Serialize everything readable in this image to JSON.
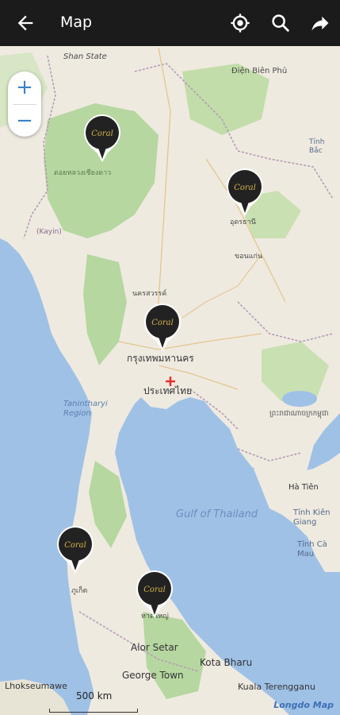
{
  "topbar": {
    "title": "Map",
    "back_icon": "arrow-left-icon",
    "actions": [
      "my-location-icon",
      "search-icon",
      "share-icon"
    ]
  },
  "zoom": {
    "in_label": "+",
    "out_label": "−"
  },
  "map_labels": {
    "shan_state": "Shan State",
    "dien_bien_phu": "Điện Biên Phủ",
    "gulf": "Gulf of Thailand",
    "tanintharyi": "Tanintharyi Region",
    "kayin": "(Kayin)",
    "alor_setar": "Alor Setar",
    "kota_bharu": "Kota Bharu",
    "george_town": "George Town",
    "kuala_terengganu": "Kuala Terengganu",
    "lhokseumawe": "Lhokseumawe",
    "ha_tien": "Hà Tiên",
    "tinh_kien_giang": "Tỉnh Kiên Giang",
    "tinh_ca_mau": "Tỉnh Cà Mau",
    "tinh_bac": "Tỉnh Bắc",
    "bangkok_th": "กรุงเทพมหานคร",
    "thailand_th": "ประเทศไทย",
    "chiang_mai_th": "ดอยหลวงเชียงดาว",
    "phuket_th": "ภูเก็ต",
    "hat_yai_th": "หาดใหญ่",
    "udon_th": "อุดรธานี",
    "nakhon_sawan_th": "นครสวรรค์",
    "khon_kaen_th": "ขอนแก่น",
    "cambodia_kh": "ព្រះរាជាណាចក្រកម្ពុជា"
  },
  "markers": [
    {
      "name": "Coral",
      "location": "north"
    },
    {
      "name": "Coral",
      "location": "northeast"
    },
    {
      "name": "Coral",
      "location": "bangkok"
    },
    {
      "name": "Coral",
      "location": "phuket"
    },
    {
      "name": "Coral",
      "location": "hat-yai"
    }
  ],
  "scale": {
    "label": "500 km"
  },
  "attribution": "Longdo Map",
  "colors": {
    "sea": "#9fc1e6",
    "land": "#efeae0",
    "forest": "#b6d7a0",
    "topbar": "#1b1b1b",
    "marker": "#222222",
    "marker_text": "#d4b24a",
    "center_cross": "#e5302e"
  }
}
